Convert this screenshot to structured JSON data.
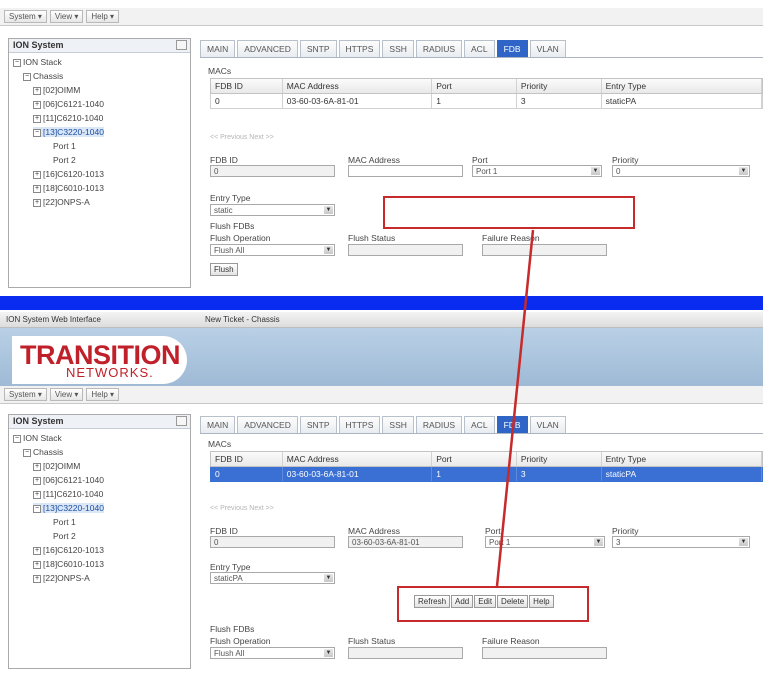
{
  "menu": [
    "System ▾",
    "View ▾",
    "Help ▾"
  ],
  "tree": {
    "title": "ION System",
    "nodes": [
      "ION Stack",
      "Chassis",
      "[02]OIMM",
      "[06]C6121-1040",
      "[11]C6210-1040",
      "[13]C3220-1040",
      "Port 1",
      "Port 2",
      "[16]C6120-1013",
      "[18]C6010-1013",
      "[22]ONPS-A"
    ],
    "selected": "[13]C3220-1040"
  },
  "tabs": [
    "MAIN",
    "ADVANCED",
    "SNTP",
    "HTTPS",
    "SSH",
    "RADIUS",
    "ACL",
    "FDB",
    "VLAN"
  ],
  "active_tab": "FDB",
  "macs_label": "MACs",
  "grid_headers": [
    "FDB ID",
    "MAC Address",
    "Port",
    "Priority",
    "Entry Type"
  ],
  "top_row": [
    "0",
    "03-60-03-6A-81-01",
    "1",
    "3",
    "staticPA"
  ],
  "bottom_row": [
    "0",
    "03-60-03-6A-81-01",
    "1",
    "3",
    "staticPA"
  ],
  "hint_text": "<< Previous  Next >>",
  "top_form": {
    "fdb_id_label": "FDB ID",
    "fdb_id": "0",
    "mac_label": "MAC Address",
    "mac": "",
    "port_label": "Port",
    "port": "Port 1",
    "priority_label": "Priority",
    "priority": "0",
    "entry_type_label": "Entry Type",
    "entry_type": "static"
  },
  "bottom_form": {
    "fdb_id_label": "FDB ID",
    "fdb_id": "0",
    "mac_label": "MAC Address",
    "mac": "03-60-03-6A-81-01",
    "port_label": "Port",
    "port": "Port 1",
    "priority_label": "Priority",
    "priority": "3",
    "entry_type_label": "Entry Type",
    "entry_type": "staticPA"
  },
  "flush": {
    "section_label": "Flush FDBs",
    "operation_label": "Flush Operation",
    "operation": "Flush All",
    "status_label": "Flush Status",
    "failure_label": "Failure Reason",
    "button": "Flush"
  },
  "action_buttons": [
    "Refresh",
    "Add",
    "Edit",
    "Delete",
    "Help"
  ],
  "browser": {
    "tab1": "ION System Web Interface",
    "tab2": "New Ticket - Chassis"
  },
  "logo": {
    "main": "TRANSITION",
    "sub": "NETWORKS."
  },
  "colors": {
    "accent": "#2f65c7",
    "divider": "#0a2cf0",
    "annotation": "#c72a2a",
    "logo": "#c0202a"
  }
}
